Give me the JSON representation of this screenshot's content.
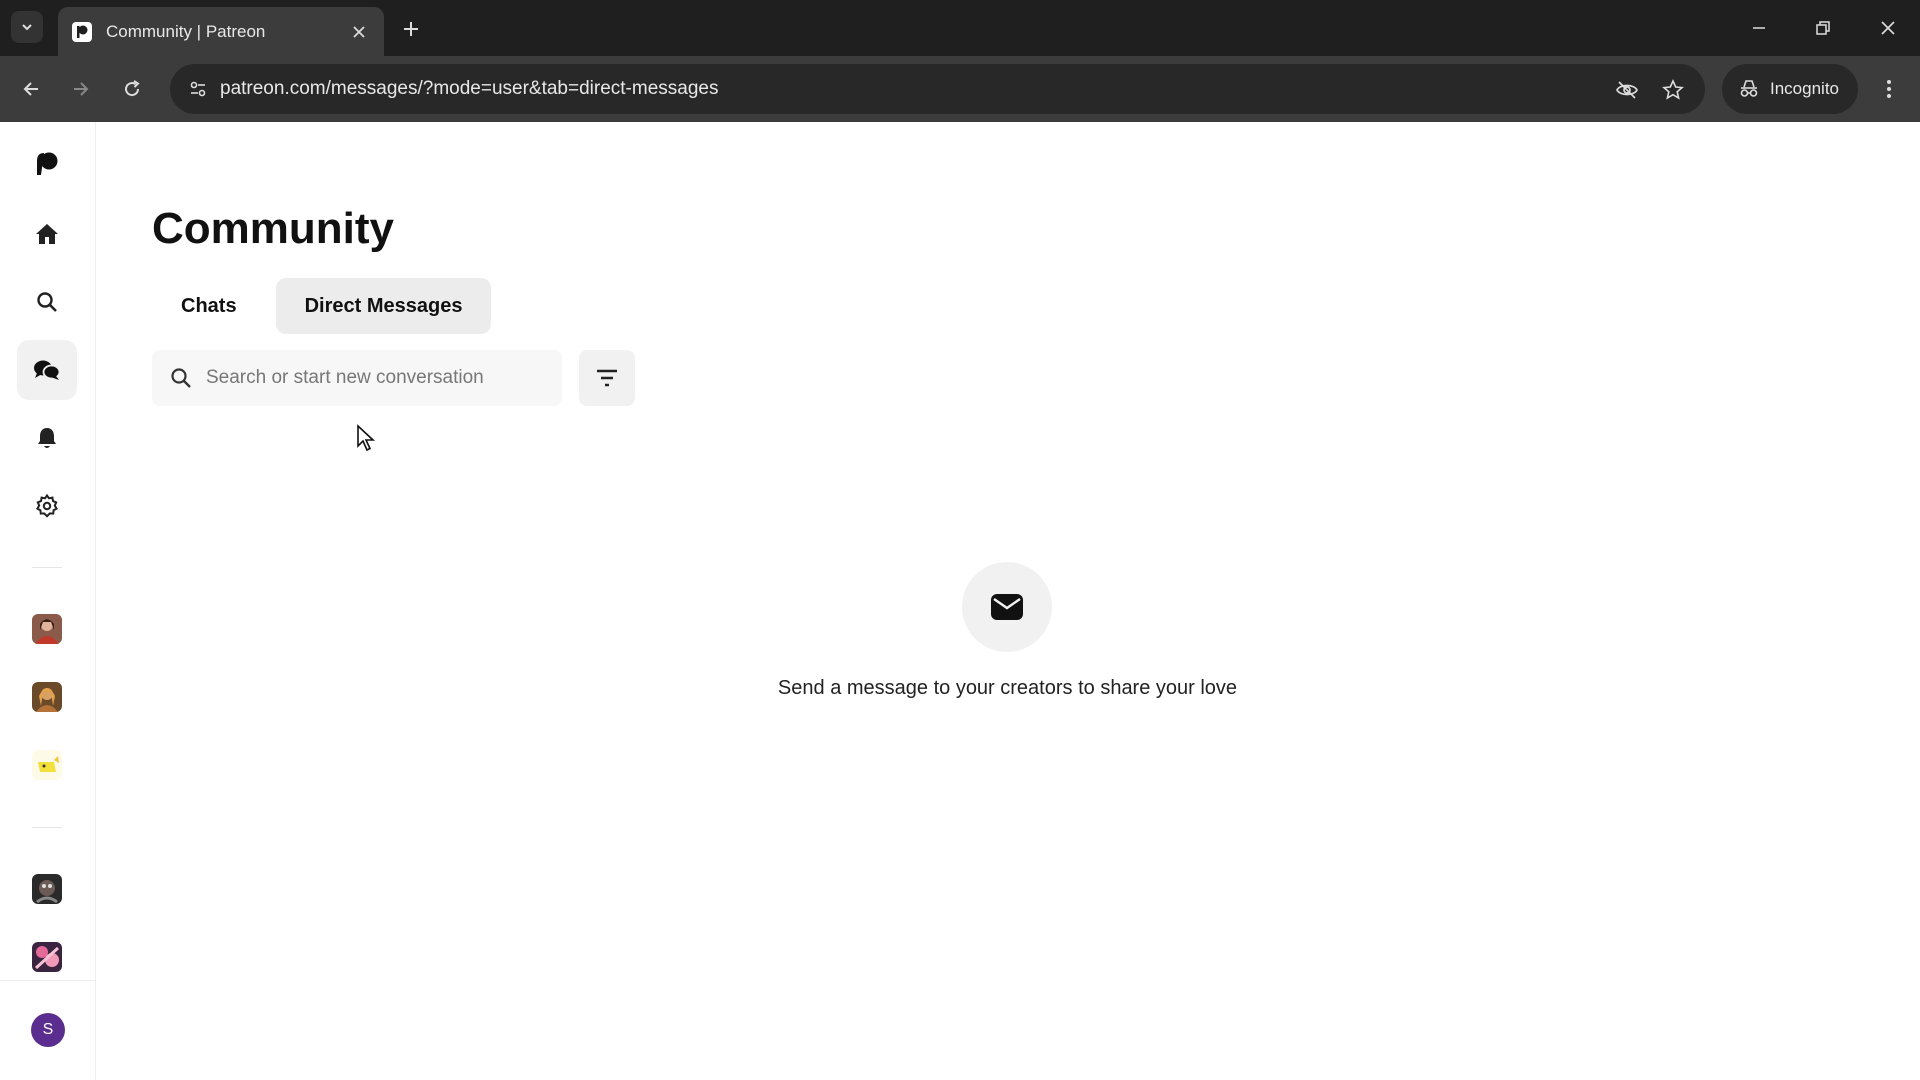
{
  "browser": {
    "tab_title": "Community | Patreon",
    "url": "patreon.com/messages/?mode=user&tab=direct-messages",
    "incognito_label": "Incognito"
  },
  "sidebar": {
    "items": [
      {
        "icon": "patreon-logo-icon"
      },
      {
        "icon": "home-icon"
      },
      {
        "icon": "search-icon"
      },
      {
        "icon": "chat-bubbles-icon",
        "active": true
      },
      {
        "icon": "bell-icon"
      },
      {
        "icon": "gear-icon"
      }
    ],
    "user_initial": "S"
  },
  "page": {
    "title": "Community",
    "tabs": [
      {
        "label": "Chats"
      },
      {
        "label": "Direct Messages",
        "active": true
      }
    ],
    "search": {
      "placeholder": "Search or start new conversation"
    },
    "empty_state": {
      "text": "Send a message to your creators to share your love"
    }
  }
}
